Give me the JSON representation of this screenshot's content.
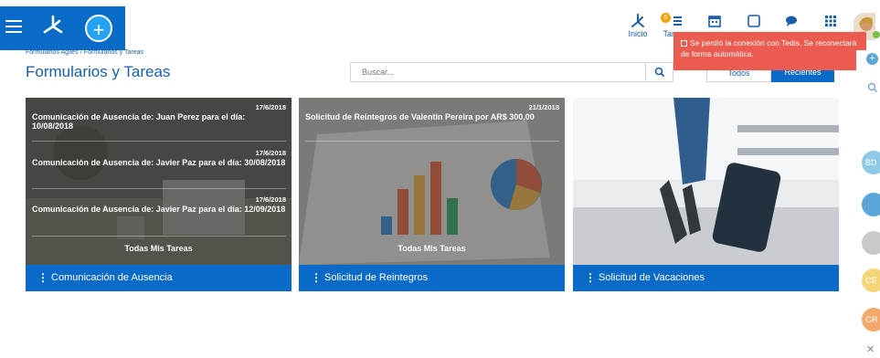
{
  "topbar": {
    "nav": [
      {
        "label": "Inicio",
        "icon": "home-icon"
      },
      {
        "label": "Tareas",
        "icon": "tasks-icon",
        "badge": "5"
      },
      {
        "label": "",
        "icon": "calendar-icon"
      },
      {
        "label": "",
        "icon": "square-icon"
      },
      {
        "label": "",
        "icon": "chat-icon"
      },
      {
        "label": "",
        "icon": "apps-grid-icon"
      }
    ],
    "accent": "#0a6ac7"
  },
  "breadcrumb": "Formularios Agiles › Formularios y Tareas",
  "page_title": "Formularios y Tareas",
  "search": {
    "placeholder": "Buscar..."
  },
  "filter": {
    "todos": "Todos",
    "recientes": "Recientes"
  },
  "toast": {
    "message": "Se perdió la conexión con Tedis. Se reconectará de forma automática.",
    "color": "#ec5b4f"
  },
  "cards": [
    {
      "tasks": [
        {
          "date": "17/6/2018",
          "text": "Comunicación de Ausencia de: Juan Perez para el día: 10/08/2018"
        },
        {
          "date": "17/6/2018",
          "text": "Comunicación de Ausencia de: Javier Paz para el día: 30/08/2018"
        },
        {
          "date": "17/6/2018",
          "text": "Comunicación de Ausencia de: Javier Paz para el día: 12/09/2018"
        }
      ],
      "todas": "Todas Mis Tareas",
      "footer": "Comunicación de Ausencia"
    },
    {
      "tasks": [
        {
          "date": "21/1/2018",
          "text": "Solicitud de Reintegros de Valentin Pereira por  AR$  300,00"
        }
      ],
      "todas": "Todas Mis Tareas",
      "footer": "Solicitud de Reintegros"
    },
    {
      "tasks": [],
      "todas": "",
      "footer": "Solicitud de Vacaciones"
    }
  ],
  "right_sidebar": {
    "contacts": [
      {
        "initials": "BD",
        "color": "#8fc9e8"
      },
      {
        "initials": "",
        "color": "#5aa6d6"
      },
      {
        "initials": "",
        "color": "#c9c9c9"
      },
      {
        "initials": "CE",
        "color": "#f5d57a"
      },
      {
        "initials": "GR",
        "color": "#f2a86a"
      }
    ]
  }
}
